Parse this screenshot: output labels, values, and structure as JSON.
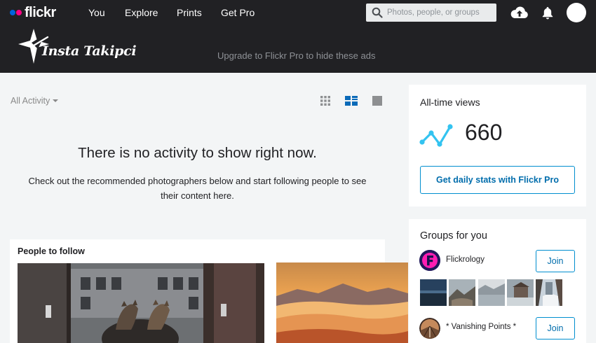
{
  "nav": {
    "logo": "flickr",
    "links": [
      "You",
      "Explore",
      "Prints",
      "Get Pro"
    ],
    "search_placeholder": "Photos, people, or groups"
  },
  "ad": {
    "logo_text": "Insta Takipci",
    "message": "Upgrade to Flickr Pro to hide these ads"
  },
  "feed": {
    "filter_label": "All Activity",
    "empty_title": "There is no activity to show right now.",
    "empty_message": "Check out the recommended photographers below and start following people to see their content here.",
    "people_title": "People to follow"
  },
  "stats": {
    "title": "All-time views",
    "value": "660",
    "button": "Get daily stats with Flickr Pro"
  },
  "groups": {
    "title": "Groups for you",
    "items": [
      {
        "name": "Flickrology",
        "join_label": "Join"
      },
      {
        "name": "* Vanishing Points *",
        "join_label": "Join"
      }
    ]
  },
  "colors": {
    "topbar": "#212124",
    "flickr_blue": "#0063dc",
    "flickr_pink": "#ff0084",
    "accent": "#008ecf",
    "stats_line": "#33c3f0"
  }
}
